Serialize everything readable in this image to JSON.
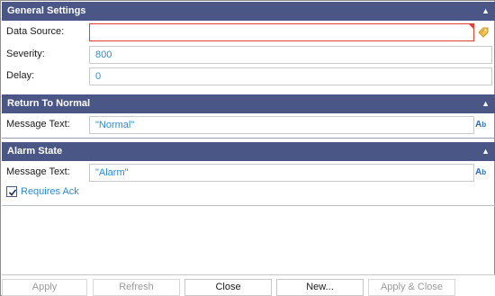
{
  "general": {
    "header": "General Settings",
    "data_source_label": "Data Source:",
    "data_source_value": "",
    "severity_label": "Severity:",
    "severity_value": "800",
    "delay_label": "Delay:",
    "delay_value": "0"
  },
  "return_to_normal": {
    "header": "Return To Normal",
    "message_label": "Message Text:",
    "message_value": "\"Normal\""
  },
  "alarm_state": {
    "header": "Alarm State",
    "message_label": "Message Text:",
    "message_value": "\"Alarm\"",
    "requires_ack_label": "Requires Ack",
    "requires_ack_checked": true
  },
  "footer": {
    "apply": "Apply",
    "refresh": "Refresh",
    "close": "Close",
    "new": "New...",
    "apply_close": "Apply & Close"
  },
  "colors": {
    "header_bg": "#4a5686",
    "value_text": "#2e8bcf",
    "error_border": "#e2412f"
  },
  "icons": {
    "tag_browse": "tag-icon",
    "text_edit": "text-edit-icon",
    "collapse": "chevron-up-icon"
  }
}
